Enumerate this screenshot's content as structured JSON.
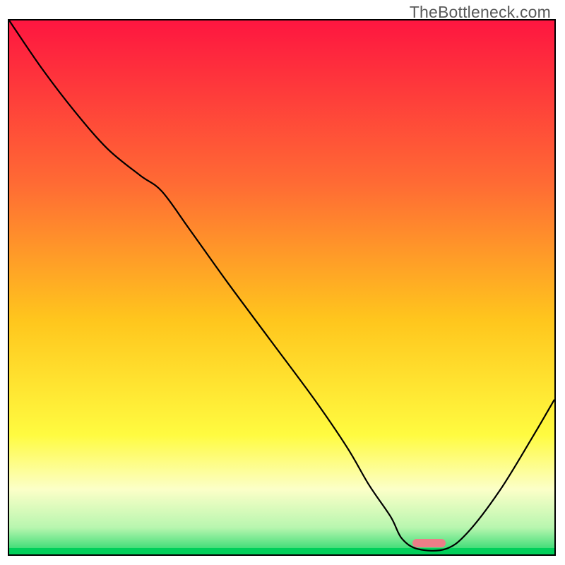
{
  "attribution": "TheBottleneck.com",
  "colors": {
    "frame": "#000000",
    "watermark": "#595959",
    "curve": "#000000",
    "marker": "#eb7e88",
    "gradient_stops": [
      {
        "pct": 0,
        "color": "#fe1640"
      },
      {
        "pct": 30,
        "color": "#ff6b34"
      },
      {
        "pct": 55,
        "color": "#ffc61d"
      },
      {
        "pct": 76,
        "color": "#fffb40"
      },
      {
        "pct": 86,
        "color": "#fcffc8"
      },
      {
        "pct": 93,
        "color": "#b8f6af"
      },
      {
        "pct": 99,
        "color": "#01cf5a"
      },
      {
        "pct": 100,
        "color": "#01cf5a"
      }
    ]
  },
  "chart_data": {
    "type": "line",
    "title": "",
    "xlabel": "",
    "ylabel": "",
    "xlim": [
      0,
      100
    ],
    "ylim": [
      0,
      100
    ],
    "grid": false,
    "legend": "none",
    "series": [
      {
        "name": "bottleneck-curve",
        "x": [
          0,
          6,
          12,
          18,
          24,
          28,
          33,
          40,
          48,
          56,
          62,
          66,
          70,
          72,
          75,
          80,
          84,
          90,
          96,
          100
        ],
        "y": [
          100,
          91,
          83,
          76,
          71,
          68,
          61,
          51,
          40,
          29,
          20,
          13,
          7,
          3,
          1,
          1,
          4,
          12,
          22,
          29
        ]
      }
    ],
    "annotations": [
      {
        "type": "marker",
        "shape": "rounded-bar",
        "x_start": 74,
        "x_end": 80,
        "y": 0.8,
        "color": "#eb7e88"
      }
    ],
    "notes": "No axis ticks or numeric labels are visible in the source image; x and y values are read off relative to the frame (0–100) by estimating curve position against the gradient background."
  },
  "marker": {
    "x_start_pct": 74,
    "x_end_pct": 80,
    "y_from_bottom_pct": 1.3
  }
}
